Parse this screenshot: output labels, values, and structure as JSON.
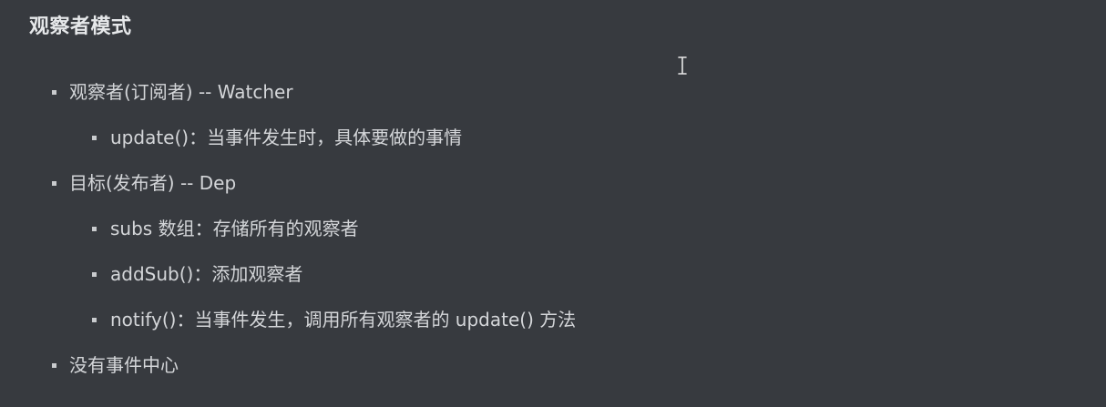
{
  "page": {
    "title": "观察者模式"
  },
  "list": {
    "items": [
      {
        "text": "观察者(订阅者)  -- Watcher"
      },
      {
        "text": "update()：当事件发生时，具体要做的事情"
      },
      {
        "text": "目标(发布者) -- Dep"
      },
      {
        "text": "subs 数组：存储所有的观察者"
      },
      {
        "text": "addSub()：添加观察者"
      },
      {
        "text": "notify()：当事件发生，调用所有观察者的 update() 方法"
      },
      {
        "text": "没有事件中心"
      }
    ]
  },
  "colors": {
    "background": "#373a3f",
    "text": "#d4d6d9",
    "title": "#e6e8ea"
  },
  "icons": {
    "cursor": "text-cursor-icon",
    "bullet": "square-bullet-icon"
  }
}
